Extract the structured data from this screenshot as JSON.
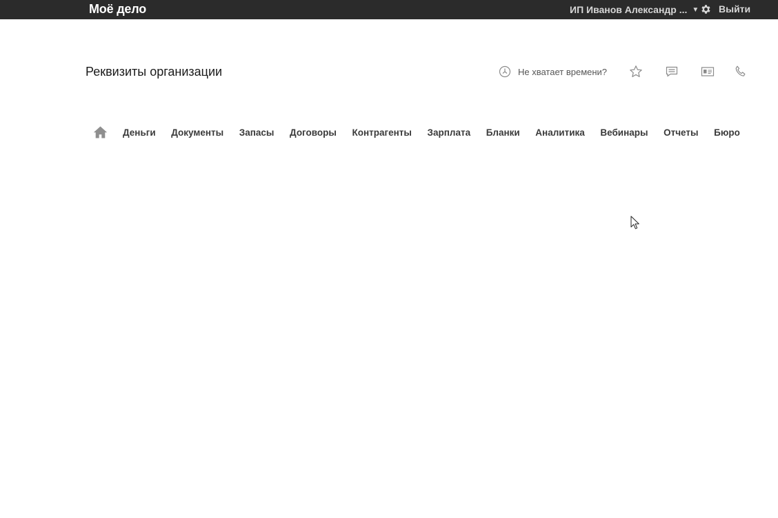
{
  "header": {
    "logo_text": "Моё дело",
    "user_name": "ИП Иванов Александр ...",
    "caret_glyph": "▼",
    "logout_label": "Выйти",
    "settings_icon": "gear-icon",
    "colors": {
      "background": "#2b2b2b",
      "text": "#d6d6d6"
    }
  },
  "page": {
    "title": "Реквизиты организации",
    "help_label": "Не хватает времени?",
    "help_icon": "clock-icon",
    "tools": [
      "star-icon",
      "chat-icon",
      "contact-card-icon",
      "phone-icon"
    ]
  },
  "nav": {
    "home_icon": "home-icon",
    "items": [
      "Деньги",
      "Документы",
      "Запасы",
      "Договоры",
      "Контрагенты",
      "Зарплата",
      "Бланки",
      "Аналитика",
      "Вебинары",
      "Отчеты",
      "Бюро"
    ]
  }
}
